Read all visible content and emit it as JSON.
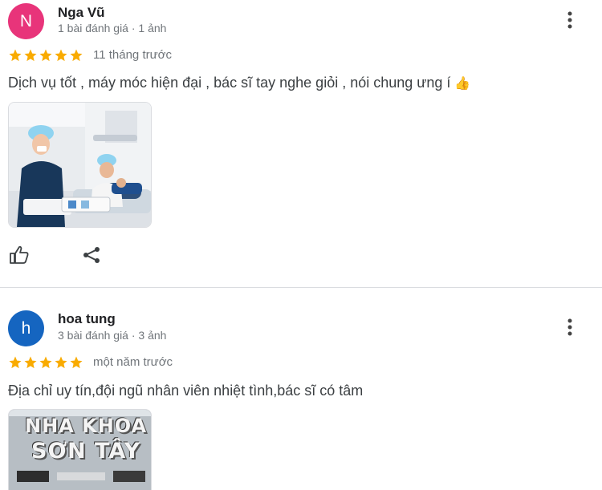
{
  "reviews": [
    {
      "avatar_letter": "N",
      "avatar_color": "#e8347a",
      "name": "Nga Vũ",
      "meta": "1 bài đánh giá · 1 ảnh",
      "rating": 5,
      "time": "11 tháng trước",
      "text": "Dịch vụ tốt , máy móc hiện đại , bác sĩ tay nghe giỏi , nói chung ưng í",
      "emoji": "👍",
      "photo": "dental-clinic-photo"
    },
    {
      "avatar_letter": "h",
      "avatar_color": "#1565c0",
      "name": "hoa tung",
      "meta": "3 bài đánh giá · 3 ảnh",
      "rating": 5,
      "time": "một năm trước",
      "text": "Địa chỉ uy tín,đội ngũ nhân viên nhiệt tình,bác sĩ có tâm",
      "photo": "clinic-sign-photo",
      "sign_line1": "NHA KHOA",
      "sign_line2": "SƠN TÂY"
    }
  ],
  "icons": {
    "more": "more-vertical-icon",
    "star": "star-icon",
    "like": "thumbs-up-icon",
    "share": "share-icon"
  },
  "colors": {
    "star": "#f9ab00",
    "secondary_text": "#70757a",
    "divider": "#dadce0"
  }
}
